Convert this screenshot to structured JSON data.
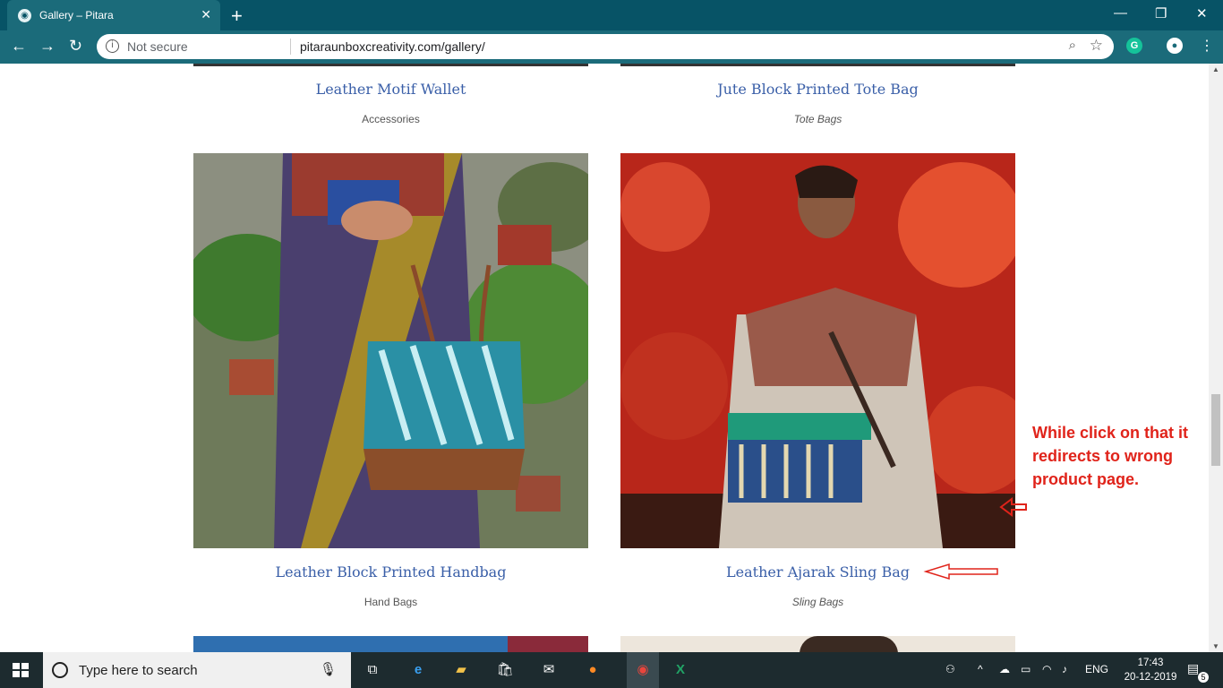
{
  "browser": {
    "tab_title": "Gallery – Pitara",
    "address_status": "Not secure",
    "url": "pitaraunboxcreativity.com/gallery/"
  },
  "gallery": {
    "row1": [
      {
        "title": "Leather Motif Wallet",
        "category": "Accessories"
      },
      {
        "title": "Jute Block Printed Tote Bag",
        "category": "Tote Bags"
      }
    ],
    "row2": [
      {
        "title": "Leather Block Printed Handbag",
        "category": "Hand Bags"
      },
      {
        "title": "Leather Ajarak Sling Bag",
        "category": "Sling Bags"
      }
    ]
  },
  "annotation": {
    "text": "While click on that it redirects to wrong product page.",
    "color": "#e0231a"
  },
  "taskbar": {
    "search_placeholder": "Type here to search",
    "language": "ENG",
    "time": "17:43",
    "date": "20-12-2019",
    "notification_count": "5"
  },
  "colors": {
    "chrome_tab": "#075366",
    "chrome_toolbar": "#1b6b7a",
    "product_title": "#3a5fa8"
  }
}
